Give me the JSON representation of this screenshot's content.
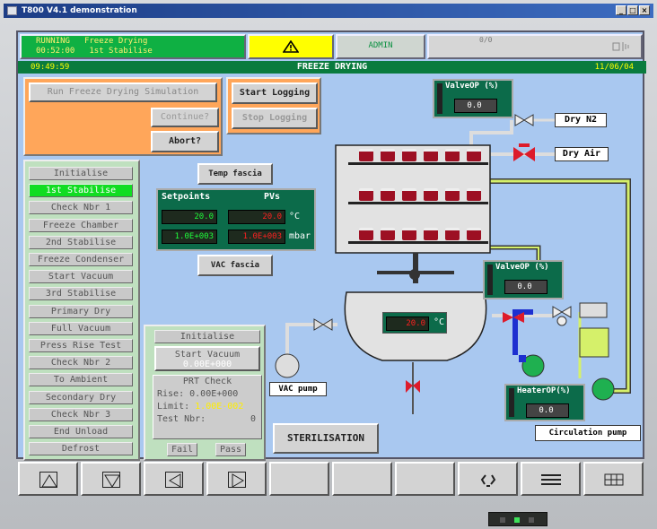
{
  "window": {
    "title": "T800 V4.1 demonstration",
    "controls": [
      "_",
      "□",
      "×"
    ]
  },
  "header": {
    "status_running": "RUNNING",
    "status_time": "00:52:00",
    "status_line1": "Freeze Drying",
    "status_line2": "1st Stabilise",
    "alarm_icon": "warning-triangle",
    "user": "ADMIN",
    "counter": "0/0",
    "nav_clock": "09:49:59",
    "section_title": "FREEZE DRYING",
    "date": "11/06/04"
  },
  "sim": {
    "run_label": "Run Freeze Drying Simulation",
    "continue_label": "Continue?",
    "abort_label": "Abort?"
  },
  "logging": {
    "start_label": "Start Logging",
    "stop_label": "Stop Logging"
  },
  "steps": [
    "Initialise",
    "1st Stabilise",
    "Check Nbr 1",
    "Freeze Chamber",
    "2nd Stabilise",
    "Freeze Condenser",
    "Start Vacuum",
    "3rd Stabilise",
    "Primary Dry",
    "Full Vacuum",
    "Press Rise Test",
    "Check Nbr 2",
    "To Ambient",
    "Secondary Dry",
    "Check Nbr 3",
    "End Unload",
    "Defrost"
  ],
  "active_step": "1st Stabilise",
  "temp_fascia_label": "Temp fascia",
  "vac_fascia_label": "VAC fascia",
  "setpoints": {
    "title_left": "Setpoints",
    "title_right": "PVs",
    "sp_temp": "20.0",
    "pv_temp": "20.0",
    "unit_temp": "°C",
    "sp_press": "1.0E+003",
    "pv_press": "1.0E+003",
    "unit_press": "mbar"
  },
  "prt": {
    "initialise": "Initialise",
    "start_vacuum": "Start Vacuum",
    "vac_value": "0.00E+000",
    "title": "PRT Check",
    "rise_label": "Rise:",
    "rise_value": "0.00E+000",
    "limit_label": "Limit:",
    "limit_value": "1.00E-002",
    "test_label": "Test Nbr:",
    "test_value": "0",
    "fail_label": "Fail",
    "pass_label": "Pass"
  },
  "sterilisation_label": "STERILISATION",
  "valve1": {
    "title": "ValveOP (%)",
    "value": "0.0"
  },
  "valve2": {
    "title": "ValveOP (%)",
    "value": "0.0"
  },
  "heater": {
    "title": "HeaterOP(%)",
    "value": "0.0"
  },
  "chamber_temp": "20.0",
  "chamber_unit": "°C",
  "labels": {
    "dry_n2": "Dry N2",
    "dry_air": "Dry Air",
    "vac_pump": "VAC pump",
    "circulation_pump": "Circulation pump"
  },
  "bottom_buttons": [
    "up-triangle-icon",
    "down-triangle-icon",
    "left-triangle-icon",
    "right-triangle-icon",
    "blank",
    "blank",
    "blank",
    "recycle-icon",
    "list-icon",
    "grid-icon"
  ],
  "colors": {
    "screen_bg": "#a9c8f0",
    "running_green": "#0fb043",
    "alarm_yellow": "#ffff00",
    "header_bar": "#0a7b3e",
    "panel_orange": "#ffa65a",
    "lcd_red": "#ff2020"
  }
}
